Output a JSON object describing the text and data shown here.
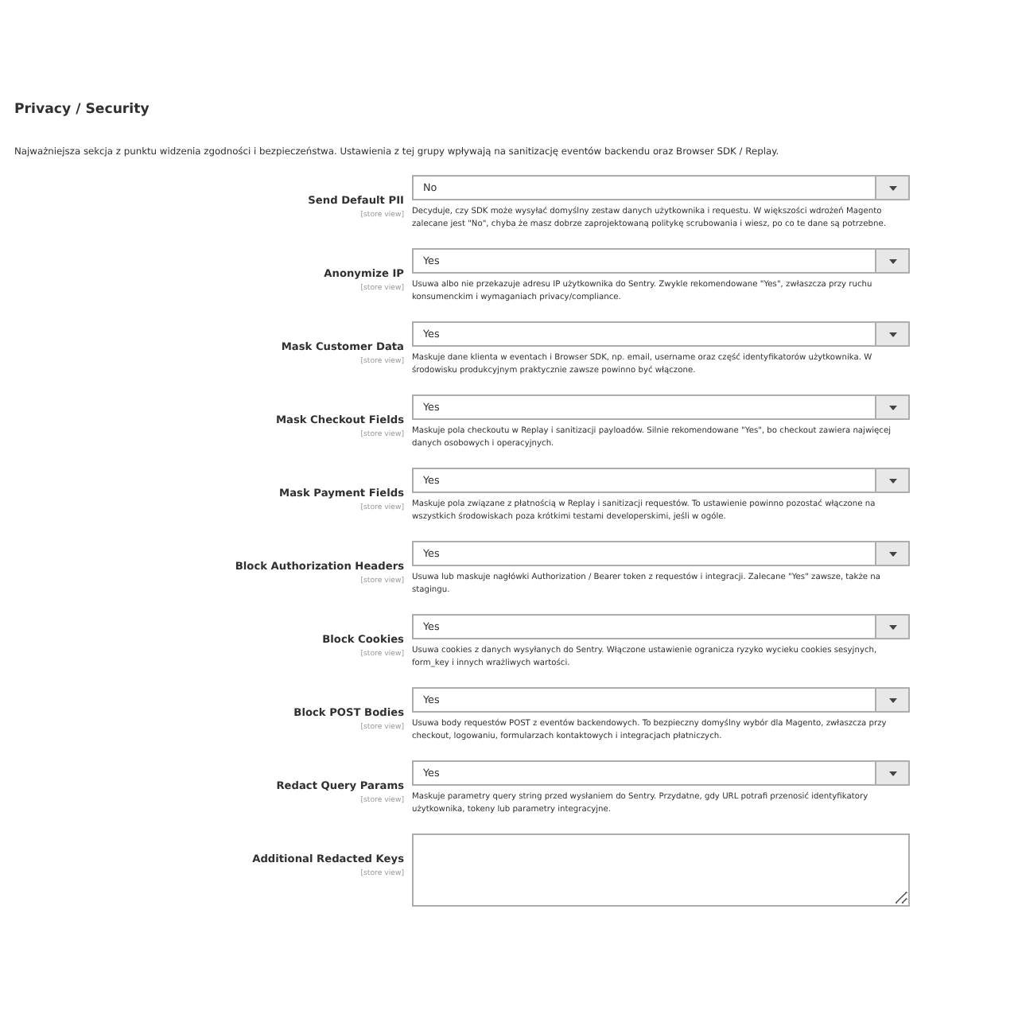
{
  "section": {
    "title": "Privacy / Security",
    "description": "Najważniejsza sekcja z punktu widzenia zgodności i bezpieczeństwa. Ustawienia z tej grupy wpływają na sanitizację eventów backendu oraz Browser SDK / Replay."
  },
  "fields": [
    {
      "kind": "select",
      "label": "Send Default PII",
      "scope": "[store view]",
      "value": "No",
      "help": "Decyduje, czy SDK może wysyłać domyślny zestaw danych użytkownika i requestu. W większości wdrożeń Magento zalecane jest \"No\", chyba że masz dobrze zaprojektowaną politykę scrubowania i wiesz, po co te dane są potrzebne."
    },
    {
      "kind": "select",
      "label": "Anonymize IP",
      "scope": "[store view]",
      "value": "Yes",
      "help": "Usuwa albo nie przekazuje adresu IP użytkownika do Sentry. Zwykle rekomendowane \"Yes\", zwłaszcza przy ruchu konsumenckim i wymaganiach privacy/compliance."
    },
    {
      "kind": "select",
      "label": "Mask Customer Data",
      "scope": "[store view]",
      "value": "Yes",
      "help": "Maskuje dane klienta w eventach i Browser SDK, np. email, username oraz część identyfikatorów użytkownika. W środowisku produkcyjnym praktycznie zawsze powinno być włączone."
    },
    {
      "kind": "select",
      "label": "Mask Checkout Fields",
      "scope": "[store view]",
      "value": "Yes",
      "help": "Maskuje pola checkoutu w Replay i sanitizacji payloadów. Silnie rekomendowane \"Yes\", bo checkout zawiera najwięcej danych osobowych i operacyjnych."
    },
    {
      "kind": "select",
      "label": "Mask Payment Fields",
      "scope": "[store view]",
      "value": "Yes",
      "help": "Maskuje pola związane z płatnością w Replay i sanitizacji requestów. To ustawienie powinno pozostać włączone na wszystkich środowiskach poza krótkimi testami developerskimi, jeśli w ogóle."
    },
    {
      "kind": "select",
      "label": "Block Authorization Headers",
      "scope": "[store view]",
      "value": "Yes",
      "help": "Usuwa lub maskuje nagłówki Authorization / Bearer token z requestów i integracji. Zalecane \"Yes\" zawsze, także na stagingu."
    },
    {
      "kind": "select",
      "label": "Block Cookies",
      "scope": "[store view]",
      "value": "Yes",
      "help": "Usuwa cookies z danych wysyłanych do Sentry. Włączone ustawienie ogranicza ryzyko wycieku cookies sesyjnych, form_key i innych wrażliwych wartości."
    },
    {
      "kind": "select",
      "label": "Block POST Bodies",
      "scope": "[store view]",
      "value": "Yes",
      "help": "Usuwa body requestów POST z eventów backendowych. To bezpieczny domyślny wybór dla Magento, zwłaszcza przy checkout, logowaniu, formularzach kontaktowych i integracjach płatniczych."
    },
    {
      "kind": "select",
      "label": "Redact Query Params",
      "scope": "[store view]",
      "value": "Yes",
      "help": "Maskuje parametry query string przed wysłaniem do Sentry. Przydatne, gdy URL potrafi przenosić identyfikatory użytkownika, tokeny lub parametry integracyjne."
    },
    {
      "kind": "textarea",
      "label": "Additional Redacted Keys",
      "scope": "[store view]"
    }
  ]
}
